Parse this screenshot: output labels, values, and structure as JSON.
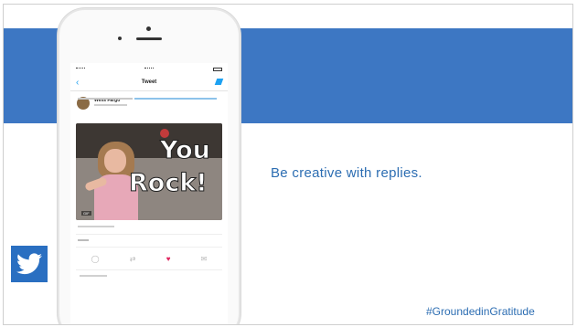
{
  "slide": {
    "caption": "Be creative with replies.",
    "hashtag": "#GroundedinGratitude"
  },
  "phone": {
    "nav_title": "Tweet",
    "back_icon": "chevron-left-icon",
    "compose_icon": "compose-icon",
    "user_name": "Wells Fargo",
    "gif": {
      "text_line1": "You",
      "text_line2": "Rock!",
      "badge": "GIF"
    },
    "actions": {
      "reply_icon": "reply-icon",
      "retweet_icon": "retweet-icon",
      "like_icon": "heart-icon",
      "dm_icon": "mail-icon"
    }
  },
  "colors": {
    "banner": "#3d77c3",
    "accent_text": "#2c6db2",
    "twitter_blue": "#1da1f2",
    "like_red": "#e0245e"
  }
}
